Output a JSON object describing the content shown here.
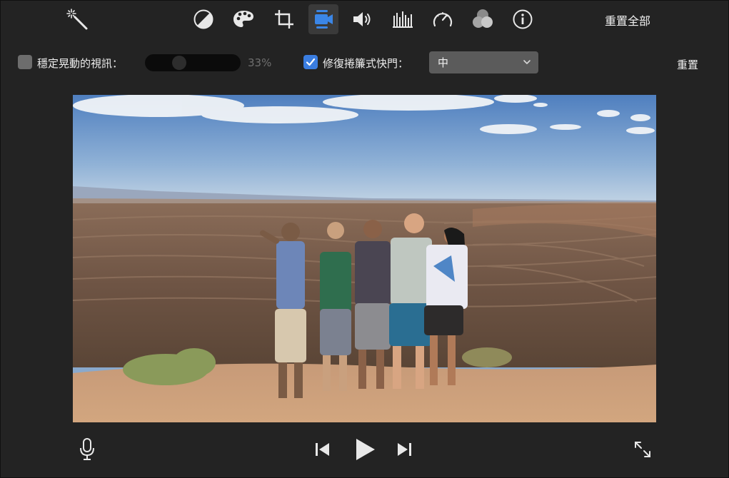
{
  "toolbar": {
    "buttons": [
      {
        "name": "magic-wand",
        "icon": "magic-wand-icon"
      },
      {
        "name": "color-balance",
        "icon": "color-balance-icon"
      },
      {
        "name": "color-correction",
        "icon": "palette-icon"
      },
      {
        "name": "crop",
        "icon": "crop-icon"
      },
      {
        "name": "stabilization",
        "icon": "video-camera-icon",
        "active": true
      },
      {
        "name": "volume",
        "icon": "speaker-icon"
      },
      {
        "name": "noise-equalizer",
        "icon": "equalizer-icon"
      },
      {
        "name": "speed",
        "icon": "speedometer-icon"
      },
      {
        "name": "clip-filter",
        "icon": "filter-circles-icon"
      },
      {
        "name": "clip-info",
        "icon": "info-icon"
      }
    ],
    "reset_all_label": "重置全部"
  },
  "options": {
    "stabilize_label": "穩定晃動的視訊：",
    "stabilize_checked": false,
    "stabilize_amount": "33%",
    "stabilize_amount_fraction": 0.33,
    "rolling_shutter_label": "修復捲簾式快門：",
    "rolling_shutter_checked": true,
    "rolling_shutter_value": "中",
    "reset_label": "重置"
  },
  "colors": {
    "accent": "#3a7de0",
    "active_icon": "#3b86e6",
    "background": "#232323"
  },
  "transport": {
    "voiceover_icon": "microphone-icon",
    "previous_icon": "skip-back-icon",
    "play_icon": "play-icon",
    "next_icon": "skip-forward-icon",
    "fullscreen_icon": "expand-icon"
  }
}
